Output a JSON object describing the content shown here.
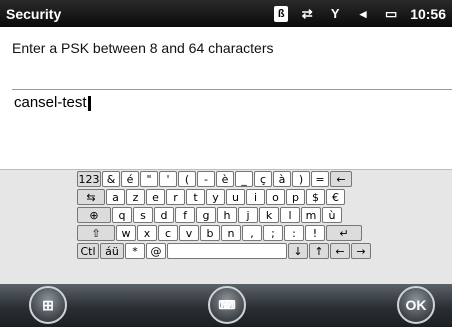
{
  "status": {
    "title": "Security",
    "time": "10:56",
    "icons": [
      "bluetooth-icon",
      "data-sync-icon",
      "signal-off-icon",
      "speaker-icon",
      "battery-icon"
    ]
  },
  "prompt": "Enter a PSK between 8 and 64 characters",
  "input": {
    "value": "cansel-test"
  },
  "keyboard": {
    "rows": [
      [
        "123",
        "&",
        "é",
        "\"",
        "'",
        "(",
        "-",
        "è",
        "_",
        "ç",
        "à",
        ")",
        "=",
        "←"
      ],
      [
        "⇆",
        "a",
        "z",
        "e",
        "r",
        "t",
        "y",
        "u",
        "i",
        "o",
        "p",
        "$",
        "€"
      ],
      [
        "⊕",
        "q",
        "s",
        "d",
        "f",
        "g",
        "h",
        "j",
        "k",
        "l",
        "m",
        "ù"
      ],
      [
        "⇧",
        "w",
        "x",
        "c",
        "v",
        "b",
        "n",
        ",",
        ";",
        ":",
        "!",
        "↵"
      ],
      [
        "Ctl",
        "áü",
        "*",
        "@",
        "",
        "↓",
        "↑",
        "←",
        "→"
      ]
    ]
  },
  "taskbar": {
    "start": "start-icon",
    "keyboard": "keyboard-icon",
    "ok": "OK"
  }
}
